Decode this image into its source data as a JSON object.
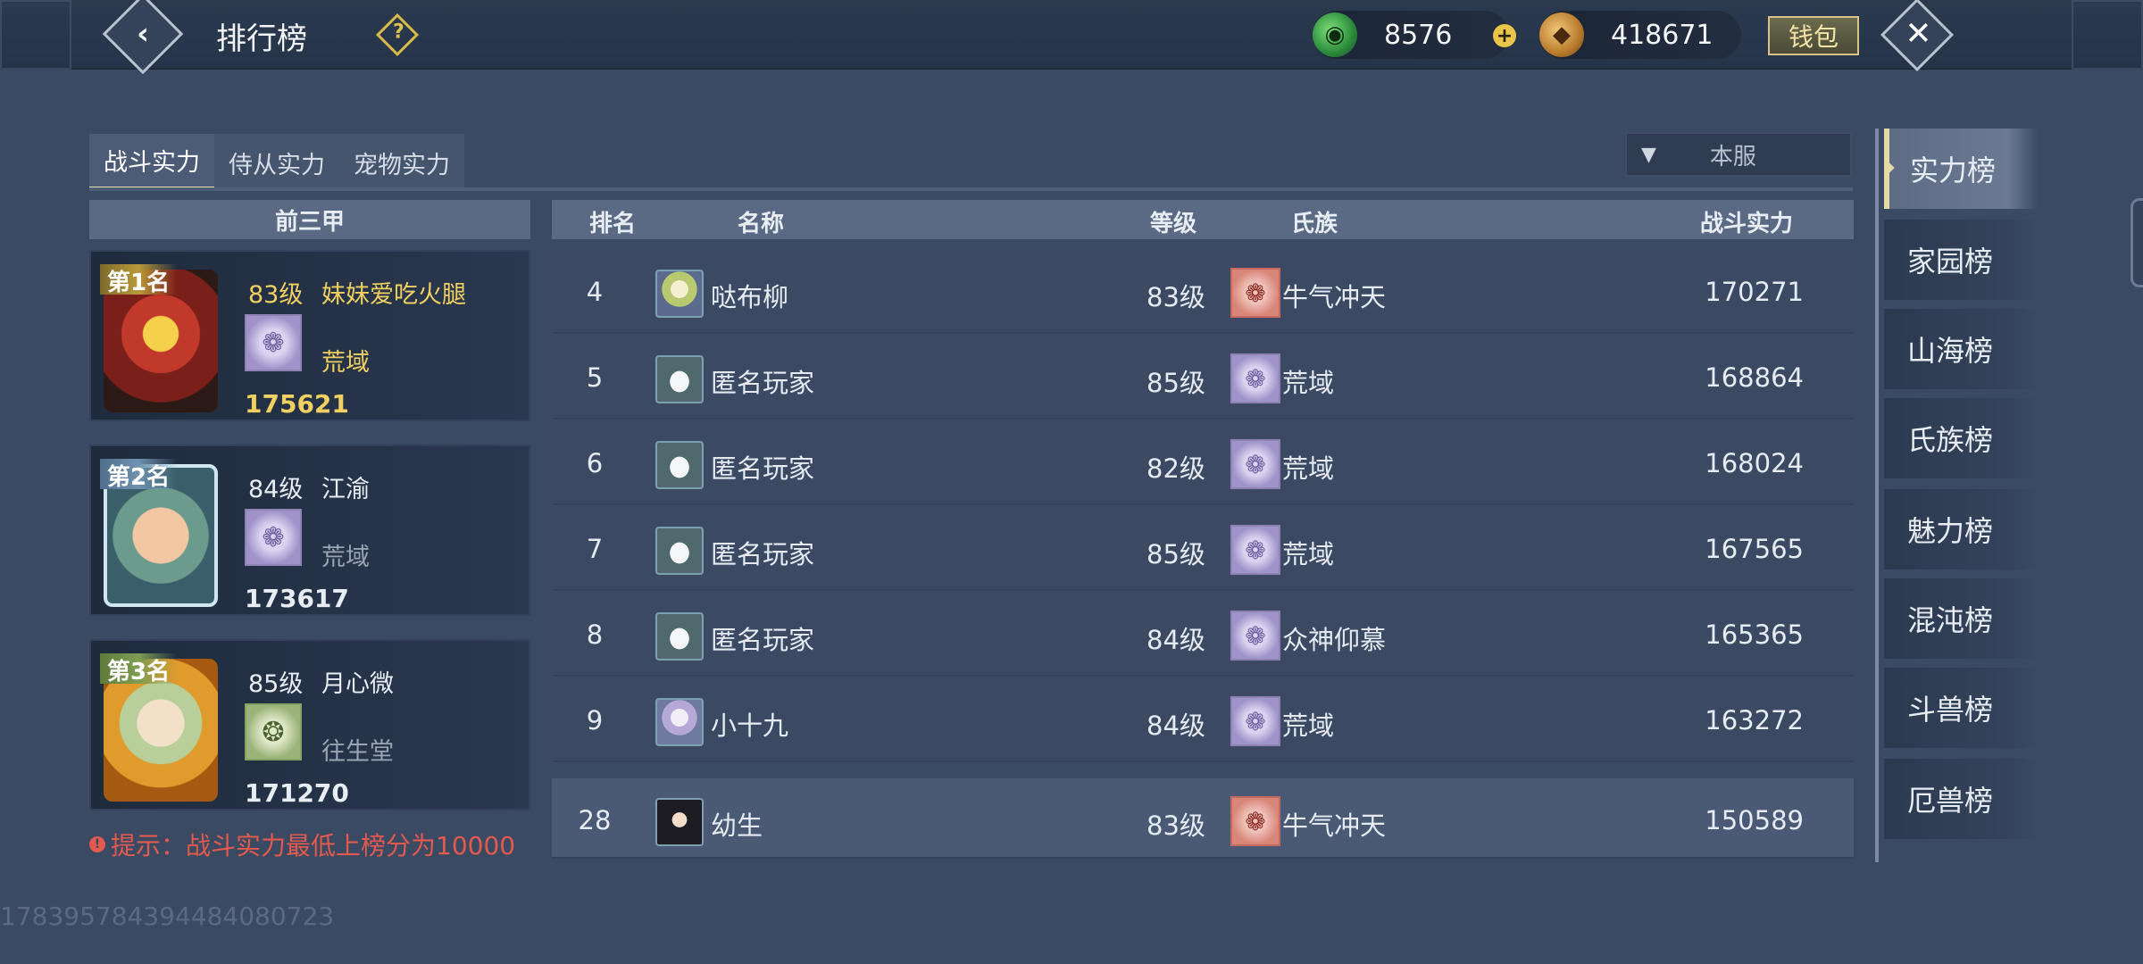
{
  "header": {
    "title": "排行榜",
    "help_icon": "question-icon",
    "jade_value": "8576",
    "coin_value": "418671",
    "wallet_label": "钱包"
  },
  "tabs": [
    {
      "label": "战斗实力",
      "active": true
    },
    {
      "label": "侍从实力",
      "active": false
    },
    {
      "label": "宠物实力",
      "active": false
    }
  ],
  "server_filter": "本服",
  "top3": {
    "header": "前三甲",
    "cards": [
      {
        "rank_label": "第1名",
        "level": "83级",
        "name": "妹妹爱吃火腿",
        "clan": "荒域",
        "power": "175621"
      },
      {
        "rank_label": "第2名",
        "level": "84级",
        "name": "江渝",
        "clan": "荒域",
        "power": "173617"
      },
      {
        "rank_label": "第3名",
        "level": "85级",
        "name": "月心微",
        "clan": "往生堂",
        "power": "171270"
      }
    ],
    "tip": "提示：战斗实力最低上榜分为10000"
  },
  "table": {
    "columns": {
      "rank": "排名",
      "name": "名称",
      "level": "等级",
      "clan": "氏族",
      "power": "战斗实力"
    },
    "rows": [
      {
        "rank": "4",
        "name": "哒布柳",
        "level": "83级",
        "clan": "牛气冲天",
        "power": "170271"
      },
      {
        "rank": "5",
        "name": "匿名玩家",
        "level": "85级",
        "clan": "荒域",
        "power": "168864"
      },
      {
        "rank": "6",
        "name": "匿名玩家",
        "level": "82级",
        "clan": "荒域",
        "power": "168024"
      },
      {
        "rank": "7",
        "name": "匿名玩家",
        "level": "85级",
        "clan": "荒域",
        "power": "167565"
      },
      {
        "rank": "8",
        "name": "匿名玩家",
        "level": "84级",
        "clan": "众神仰慕",
        "power": "165365"
      },
      {
        "rank": "9",
        "name": "小十九",
        "level": "84级",
        "clan": "荒域",
        "power": "163272"
      }
    ],
    "self_row": {
      "rank": "28",
      "name": "幼生",
      "level": "83级",
      "clan": "牛气冲天",
      "power": "150589"
    }
  },
  "side_nav": [
    {
      "label": "实力榜",
      "active": true
    },
    {
      "label": "家园榜",
      "active": false
    },
    {
      "label": "山海榜",
      "active": false
    },
    {
      "label": "氏族榜",
      "active": false
    },
    {
      "label": "魅力榜",
      "active": false
    },
    {
      "label": "混沌榜",
      "active": false
    },
    {
      "label": "斗兽榜",
      "active": false
    },
    {
      "label": "厄兽榜",
      "active": false
    }
  ],
  "watermark": "178395784394484080723",
  "colors": {
    "background": "#3a4a63",
    "rank1_text": "#f0d060",
    "highlight_clan": "#f0d060",
    "tip": "#e25a4d",
    "self_row": "#4a5a75"
  }
}
